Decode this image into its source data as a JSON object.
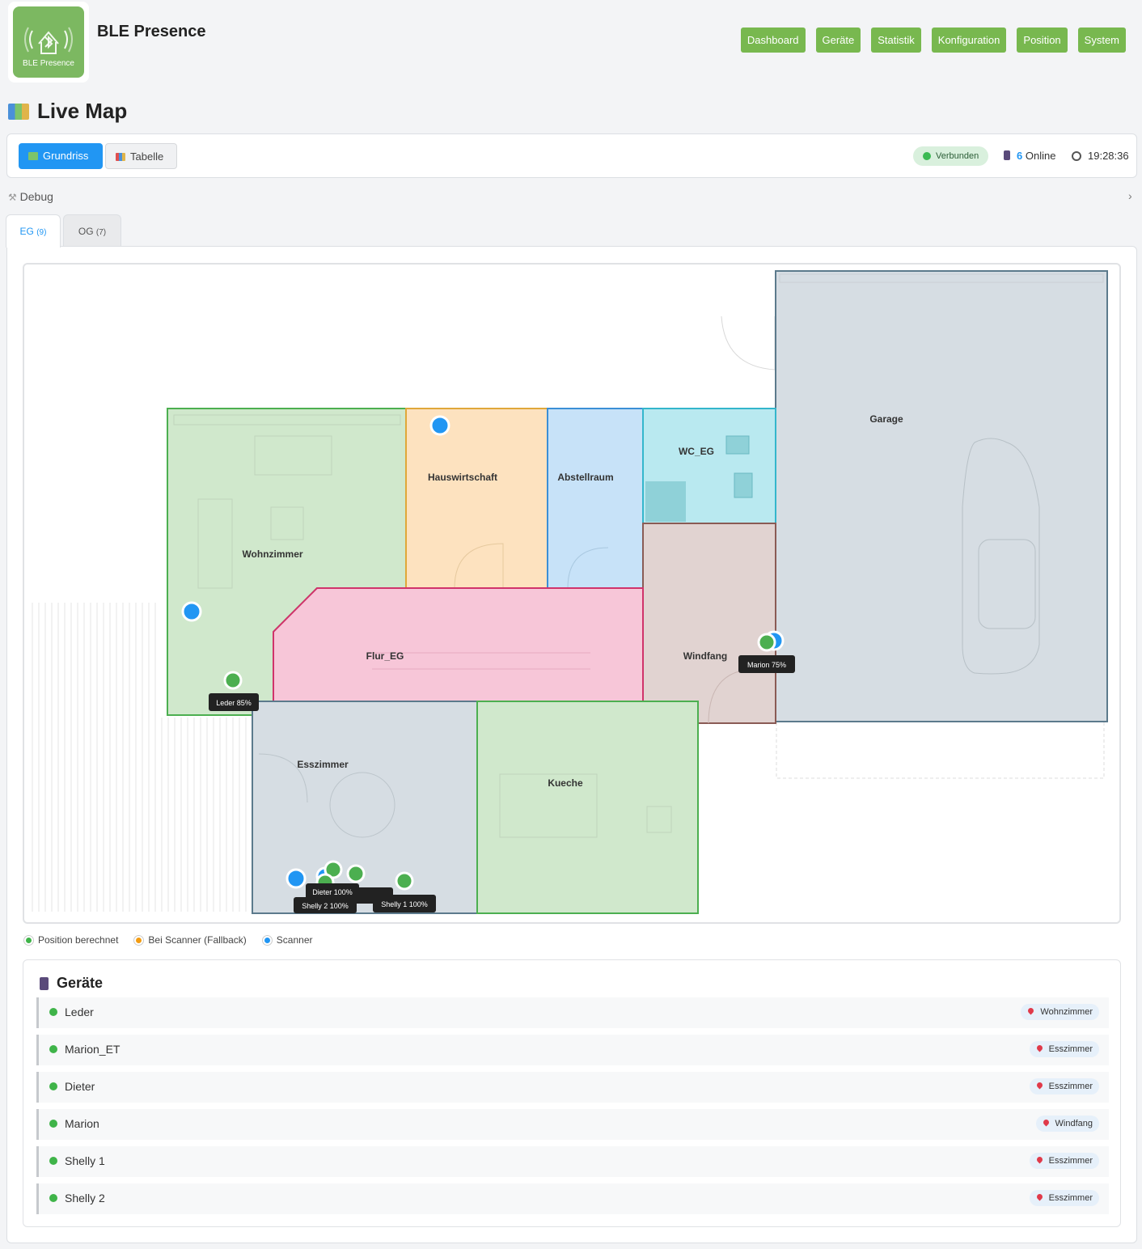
{
  "app": {
    "title": "BLE Presence",
    "logo_text": "BLE Presence"
  },
  "nav": [
    "Dashboard",
    "Geräte",
    "Statistik",
    "Konfiguration",
    "Position",
    "System"
  ],
  "page": {
    "title": "Live Map"
  },
  "toolbar": {
    "views": [
      {
        "label": "Grundriss",
        "active": true
      },
      {
        "label": "Tabelle",
        "active": false
      }
    ],
    "status": "Verbunden",
    "online_count": "6",
    "online_label": "Online",
    "time": "19:28:36"
  },
  "debug": {
    "label": "Debug"
  },
  "floors": [
    {
      "label": "EG",
      "count": "(9)",
      "active": true
    },
    {
      "label": "OG",
      "count": "(7)",
      "active": false
    }
  ],
  "rooms": [
    "Wohnzimmer",
    "Hauswirtschaft",
    "Abstellraum",
    "WC_EG",
    "Garage",
    "Flur_EG",
    "Windfang",
    "Esszimmer",
    "Kueche"
  ],
  "markers": [
    {
      "label": "Leder 85%"
    },
    {
      "label": "Marion 75%"
    },
    {
      "label": "Dieter 100%"
    },
    {
      "label": "Shelly 2 100%"
    },
    {
      "label": "Shelly 1 100%"
    }
  ],
  "legend": {
    "calculated": "Position berechnet",
    "fallback": "Bei Scanner (Fallback)",
    "scanner": "Scanner"
  },
  "colors": {
    "accent": "#2196f3",
    "nav_green": "#78b84f",
    "calculated": "#3fb449",
    "fallback": "#f39c12",
    "scanner": "#2196f3"
  },
  "devices": {
    "title": "Geräte",
    "items": [
      {
        "name": "Leder",
        "room": "Wohnzimmer"
      },
      {
        "name": "Marion_ET",
        "room": "Esszimmer"
      },
      {
        "name": "Dieter",
        "room": "Esszimmer"
      },
      {
        "name": "Marion",
        "room": "Windfang"
      },
      {
        "name": "Shelly 1",
        "room": "Esszimmer"
      },
      {
        "name": "Shelly 2",
        "room": "Esszimmer"
      }
    ]
  }
}
